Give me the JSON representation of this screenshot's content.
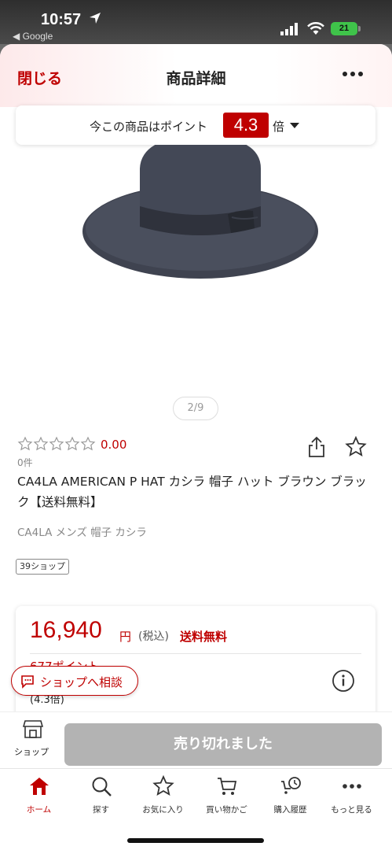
{
  "status_bar": {
    "time": "10:57",
    "back_app": "◀ Google",
    "battery": "21"
  },
  "header": {
    "close_label": "閉じる",
    "title": "商品詳細"
  },
  "points_banner": {
    "text": "今この商品はポイント",
    "rate": "4.3",
    "unit": "倍"
  },
  "gallery": {
    "indicator": "2/9"
  },
  "product": {
    "rating_value": "0.00",
    "review_count": "0件",
    "title": "CA4LA AMERICAN P HAT カシラ 帽子 ハット ブラウン ブラック【送料無料】",
    "tags": "CA4LA メンズ 帽子 カシラ",
    "shop_badge": "39ショップ",
    "stars_filled": 0,
    "stars_total": 5
  },
  "price_card": {
    "price": "16,940",
    "yen": "円",
    "tax_label": "(税込)",
    "shipping": "送料無料",
    "points_earned": "677ポイント",
    "points_detail": "(4.3倍)"
  },
  "consult": {
    "label": "ショップへ相談"
  },
  "buy_bar": {
    "shop_label": "ショップ",
    "soldout_label": "売り切れました"
  },
  "tabbar": {
    "items": [
      {
        "label": "ホーム",
        "icon": "home-icon"
      },
      {
        "label": "探す",
        "icon": "search-icon"
      },
      {
        "label": "お気に入り",
        "icon": "star-icon"
      },
      {
        "label": "買い物かご",
        "icon": "cart-icon"
      },
      {
        "label": "購入履歴",
        "icon": "history-icon"
      },
      {
        "label": "もっと見る",
        "icon": "more-icon"
      }
    ]
  },
  "colors": {
    "brand_red": "#bf0000",
    "soldout_gray": "#b3b3b3"
  }
}
